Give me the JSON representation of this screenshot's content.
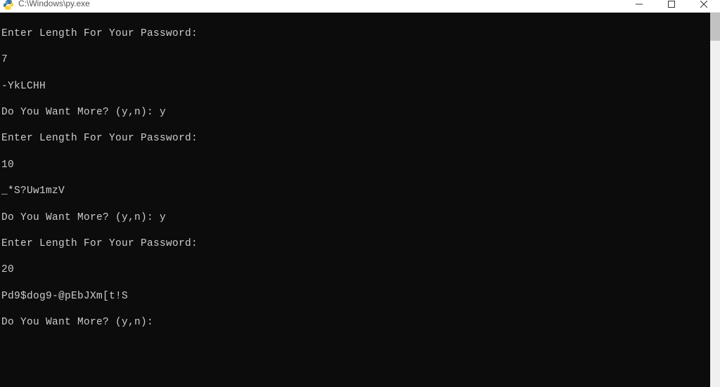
{
  "window": {
    "title": "C:\\Windows\\py.exe"
  },
  "terminal": {
    "lines": [
      "Enter Length For Your Password:",
      "7",
      "-YkLCHH",
      "Do You Want More? (y,n): y",
      "Enter Length For Your Password:",
      "10",
      "_*S?Uw1mzV",
      "Do You Want More? (y,n): y",
      "Enter Length For Your Password:",
      "20",
      "Pd9$dog9-@pEbJXm[t!S",
      "Do You Want More? (y,n):"
    ]
  }
}
